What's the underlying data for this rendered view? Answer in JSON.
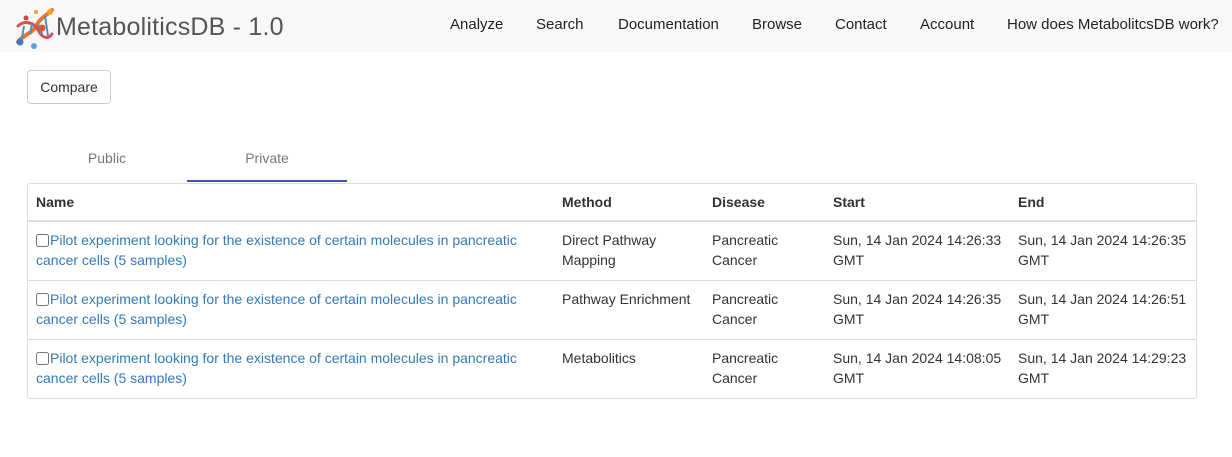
{
  "app": {
    "brand": "MetaboliticsDB - 1.0"
  },
  "nav": {
    "items": [
      {
        "label": "Analyze"
      },
      {
        "label": "Search"
      },
      {
        "label": "Documentation"
      },
      {
        "label": "Browse"
      },
      {
        "label": "Contact"
      },
      {
        "label": "Account"
      },
      {
        "label": "How does MetabolitcsDB work?"
      }
    ]
  },
  "toolbar": {
    "compare_label": "Compare"
  },
  "tabs": [
    {
      "label": "Public",
      "active": false
    },
    {
      "label": "Private",
      "active": true
    }
  ],
  "colors": {
    "link": "#337ab7",
    "active_tab_underline": "#3f51b5",
    "navbar_bg": "#f8f8f8"
  },
  "table": {
    "columns": [
      "Name",
      "Method",
      "Disease",
      "Start",
      "End"
    ],
    "rows": [
      {
        "name": "Pilot experiment looking for the existence of certain molecules in pancreatic cancer cells (5 samples)",
        "method": "Direct Pathway Mapping",
        "disease": "Pancreatic Cancer",
        "start": "Sun, 14 Jan 2024 14:26:33 GMT",
        "end": "Sun, 14 Jan 2024 14:26:35 GMT",
        "checked": false
      },
      {
        "name": "Pilot experiment looking for the existence of certain molecules in pancreatic cancer cells (5 samples)",
        "method": "Pathway Enrichment",
        "disease": "Pancreatic Cancer",
        "start": "Sun, 14 Jan 2024 14:26:35 GMT",
        "end": "Sun, 14 Jan 2024 14:26:51 GMT",
        "checked": false
      },
      {
        "name": "Pilot experiment looking for the existence of certain molecules in pancreatic cancer cells (5 samples)",
        "method": "Metabolitics",
        "disease": "Pancreatic Cancer",
        "start": "Sun, 14 Jan 2024 14:08:05 GMT",
        "end": "Sun, 14 Jan 2024 14:29:23 GMT",
        "checked": false
      }
    ]
  }
}
